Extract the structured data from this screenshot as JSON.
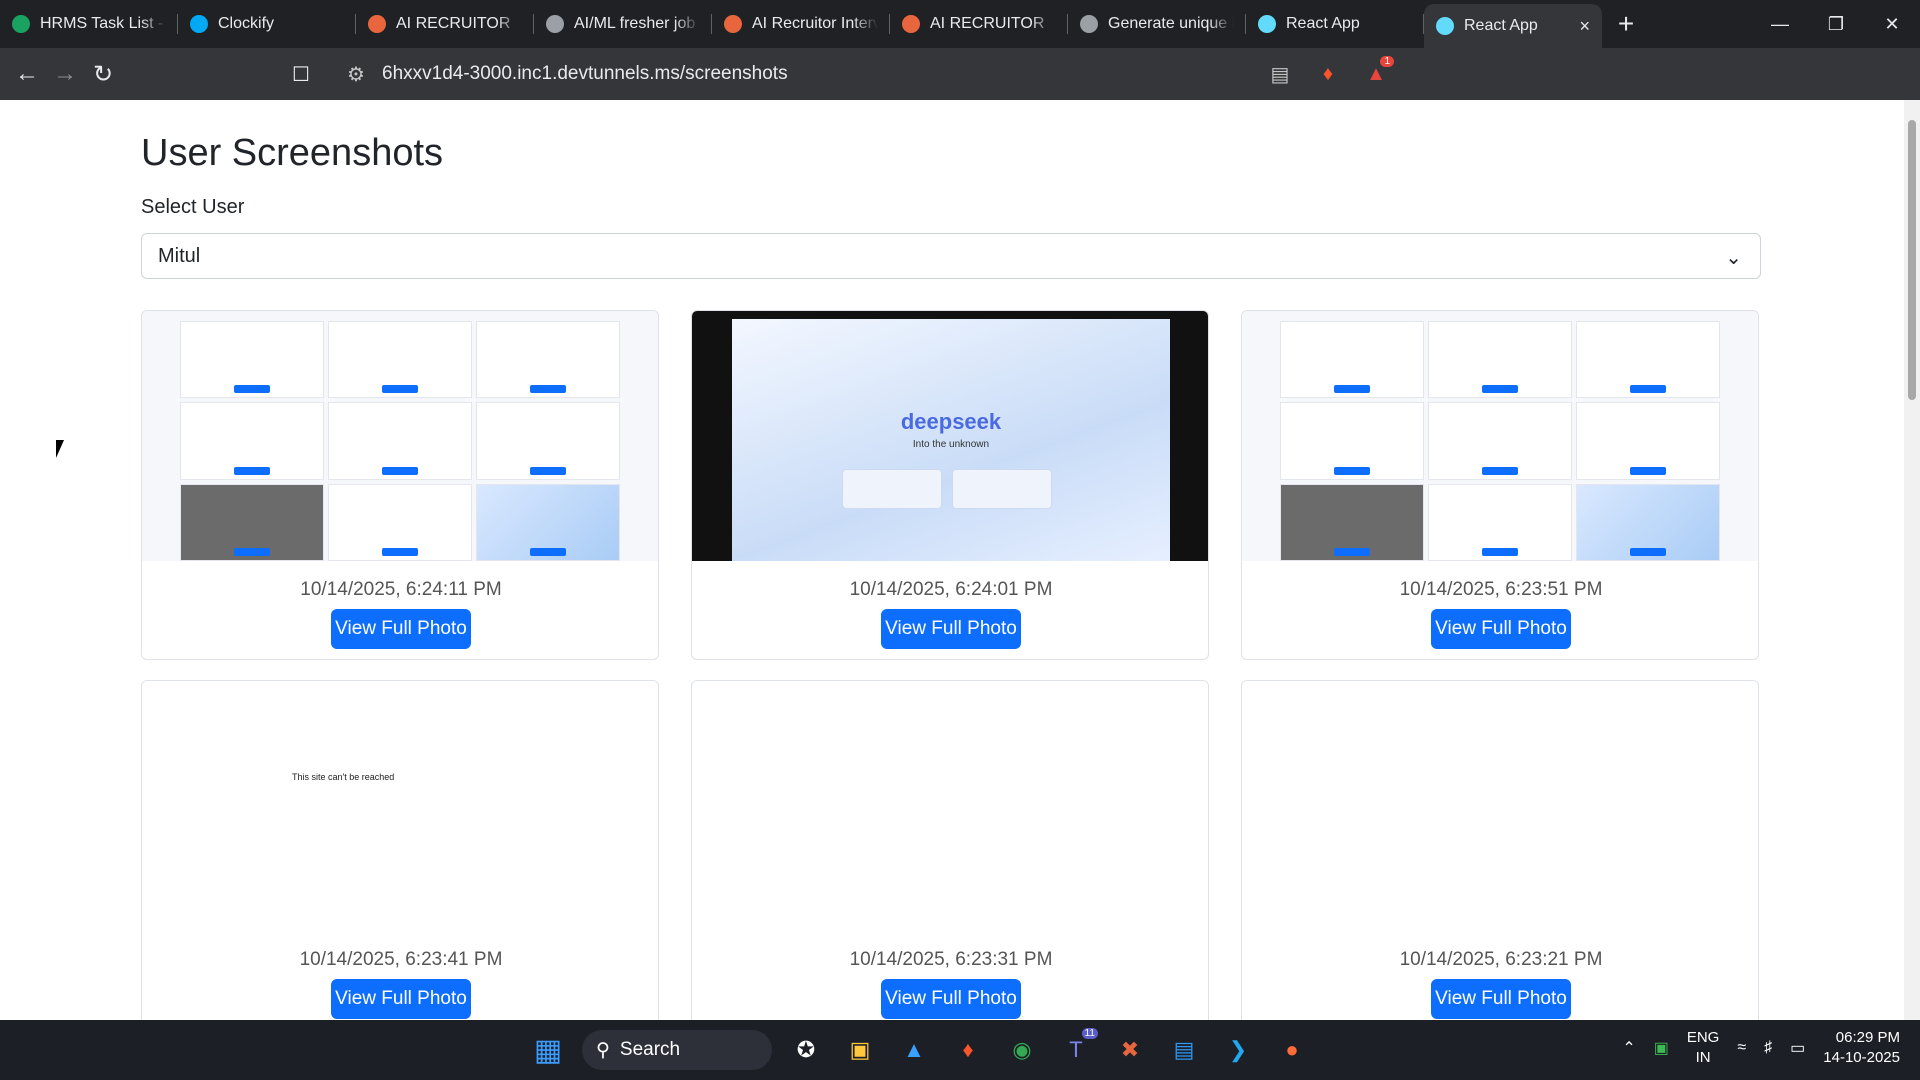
{
  "browser": {
    "tabs": [
      {
        "label": "HRMS Task List - C",
        "icon": "plus-circle-icon",
        "color": "#1aa260"
      },
      {
        "label": "Clockify",
        "icon": "clockify-icon",
        "color": "#03a9f4"
      },
      {
        "label": "AI RECRUITOR",
        "icon": "flame-icon",
        "color": "#e8663d"
      },
      {
        "label": "AI/ML fresher job",
        "icon": "openai-icon",
        "color": "#9aa0a6"
      },
      {
        "label": "AI Recruitor Interv",
        "icon": "flame-icon",
        "color": "#e8663d"
      },
      {
        "label": "AI RECRUITOR",
        "icon": "flame-icon",
        "color": "#e8663d"
      },
      {
        "label": "Generate unique ir",
        "icon": "openai-icon",
        "color": "#9aa0a6"
      },
      {
        "label": "React App",
        "icon": "react-icon",
        "color": "#61dafb"
      },
      {
        "label": "React App",
        "icon": "react-icon",
        "color": "#61dafb",
        "active": true
      }
    ],
    "url": "6hxxv1d4-3000.inc1.devtunnels.ms/screenshots",
    "brave_badge": "1"
  },
  "page": {
    "title": "User Screenshots",
    "select_label": "Select User",
    "selected_user": "Mitul"
  },
  "cards": [
    {
      "timestamp": "10/14/2025, 6:24:11 PM",
      "button": "View Full Photo",
      "thumb": "grid"
    },
    {
      "timestamp": "10/14/2025, 6:24:01 PM",
      "button": "View Full Photo",
      "thumb": "deepseek"
    },
    {
      "timestamp": "10/14/2025, 6:23:51 PM",
      "button": "View Full Photo",
      "thumb": "grid"
    },
    {
      "timestamp": "10/14/2025, 6:23:41 PM",
      "button": "View Full Photo",
      "thumb": "error"
    },
    {
      "timestamp": "10/14/2025, 6:23:31 PM",
      "button": "View Full Photo",
      "thumb": "blank"
    },
    {
      "timestamp": "10/14/2025, 6:23:21 PM",
      "button": "View Full Photo",
      "thumb": "blank"
    }
  ],
  "thumb_text": {
    "deepseek_logo": "deepseek",
    "deepseek_tagline": "Into the unknown",
    "error_title": "This site can't be reached"
  },
  "taskbar": {
    "search": "Search",
    "teams_badge": "11",
    "lang_top": "ENG",
    "lang_bottom": "IN",
    "time": "06:29 PM",
    "date": "14-10-2025"
  }
}
